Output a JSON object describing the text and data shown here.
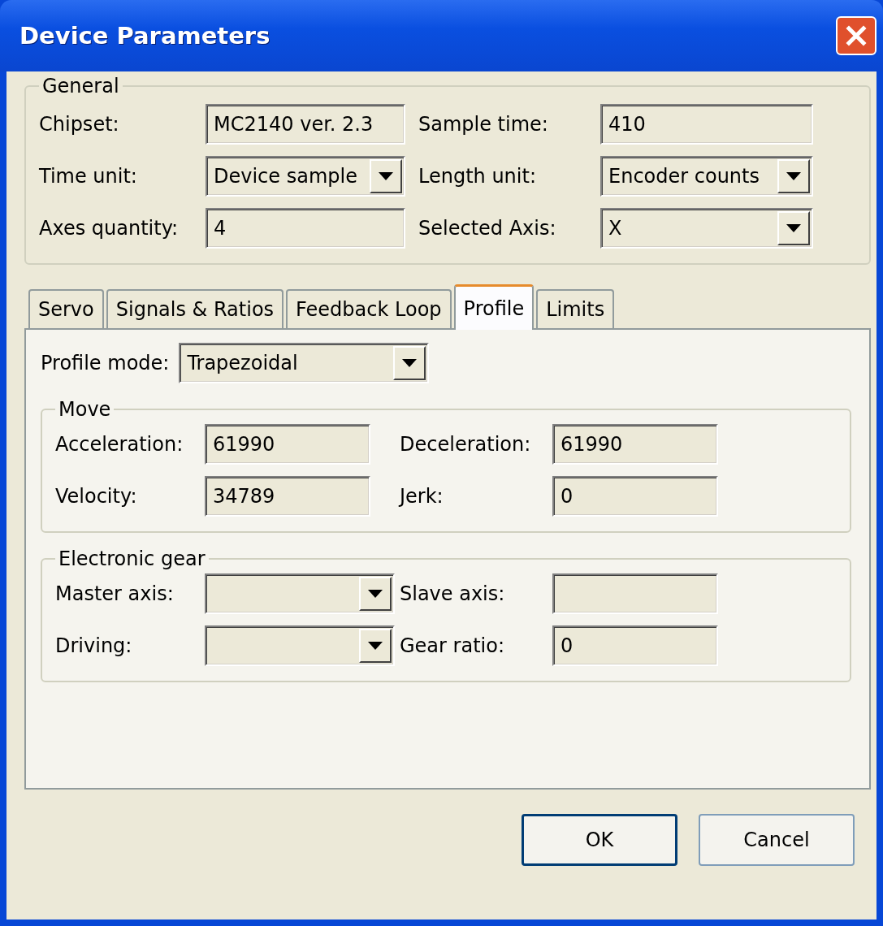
{
  "window": {
    "title": "Device Parameters"
  },
  "general": {
    "title": "General",
    "fields": [
      {
        "kind": "text",
        "label": "Chipset:",
        "value": "MC2140 ver. 2.3"
      },
      {
        "kind": "text",
        "label": "Sample time:",
        "value": "410"
      },
      {
        "kind": "dropdown",
        "label": "Time unit:",
        "value": "Device sample"
      },
      {
        "kind": "dropdown",
        "label": "Length unit:",
        "value": "Encoder counts"
      },
      {
        "kind": "text",
        "label": "Axes quantity:",
        "value": "4"
      },
      {
        "kind": "dropdown",
        "label": "Selected Axis:",
        "value": "X"
      }
    ]
  },
  "tabs": [
    {
      "label": "Servo",
      "selected": false
    },
    {
      "label": "Signals & Ratios",
      "selected": false
    },
    {
      "label": "Feedback Loop",
      "selected": false
    },
    {
      "label": "Profile",
      "selected": true
    },
    {
      "label": "Limits",
      "selected": false
    }
  ],
  "profile_mode": {
    "label": "Profile mode:",
    "value": "Trapezoidal"
  },
  "move": {
    "title": "Move",
    "fields": [
      {
        "kind": "text",
        "label": "Acceleration:",
        "value": "61990"
      },
      {
        "kind": "text",
        "label": "Deceleration:",
        "value": "61990"
      },
      {
        "kind": "text",
        "label": "Velocity:",
        "value": "34789"
      },
      {
        "kind": "text",
        "label": "Jerk:",
        "value": "0"
      }
    ]
  },
  "electronic_gear": {
    "title": "Electronic gear",
    "fields": [
      {
        "kind": "dropdown",
        "label": "Master axis:"
      },
      {
        "kind": "text",
        "label": "Slave axis:"
      },
      {
        "kind": "dropdown",
        "label": "Driving:"
      },
      {
        "kind": "text",
        "label": "Gear ratio:",
        "value": "0"
      }
    ]
  },
  "buttons": [
    {
      "label": "OK",
      "default": true
    },
    {
      "label": "Cancel",
      "default": false
    }
  ]
}
